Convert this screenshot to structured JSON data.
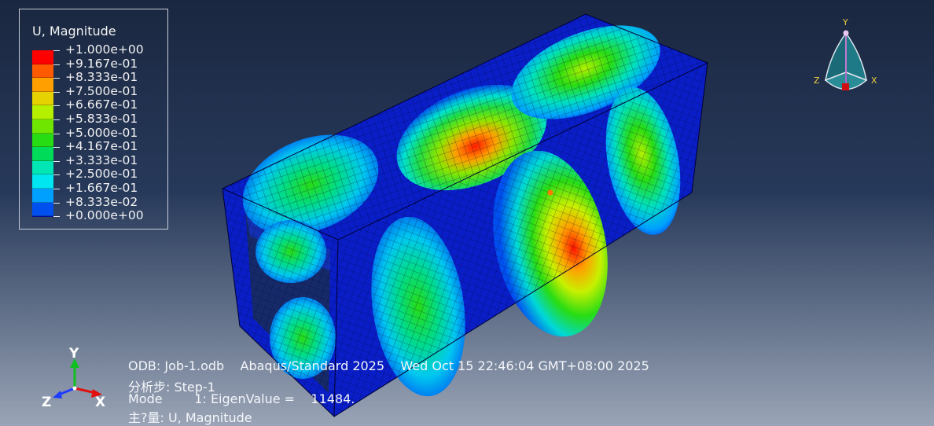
{
  "legend": {
    "title": "U, Magnitude",
    "levels": [
      {
        "label": "+1.000e+00",
        "color": "#ff0000"
      },
      {
        "label": "+9.167e-01",
        "color": "#ff5a00"
      },
      {
        "label": "+8.333e-01",
        "color": "#ffa000"
      },
      {
        "label": "+7.500e-01",
        "color": "#e6d200"
      },
      {
        "label": "+6.667e-01",
        "color": "#b4f000"
      },
      {
        "label": "+5.833e-01",
        "color": "#6ee600"
      },
      {
        "label": "+5.000e-01",
        "color": "#28dc14"
      },
      {
        "label": "+4.167e-01",
        "color": "#00dc5a"
      },
      {
        "label": "+3.333e-01",
        "color": "#00e6b4"
      },
      {
        "label": "+2.500e-01",
        "color": "#00e6f0"
      },
      {
        "label": "+1.667e-01",
        "color": "#00a0ff"
      },
      {
        "label": "+8.333e-02",
        "color": "#0050f0"
      },
      {
        "label": "+0.000e+00",
        "color": "#0014c8"
      }
    ]
  },
  "info": {
    "odb": "ODB: Job-1.odb    Abaqus/Standard 2025    Wed Oct 15 22:46:04 GMT+08:00 2025",
    "step": "分析步: Step-1",
    "mode": "Mode        1: EigenValue =    11484.",
    "primary_var": "主?量: U, Magnitude"
  },
  "triad": {
    "x": "X",
    "y": "Y",
    "z": "Z"
  },
  "view_cube": {
    "x": "X",
    "y": "Y",
    "z": "Z"
  },
  "colors": {
    "mesh_blue": "#0a1ec8",
    "background_top": "#1a2740",
    "background_bottom": "#9aa4b6"
  }
}
